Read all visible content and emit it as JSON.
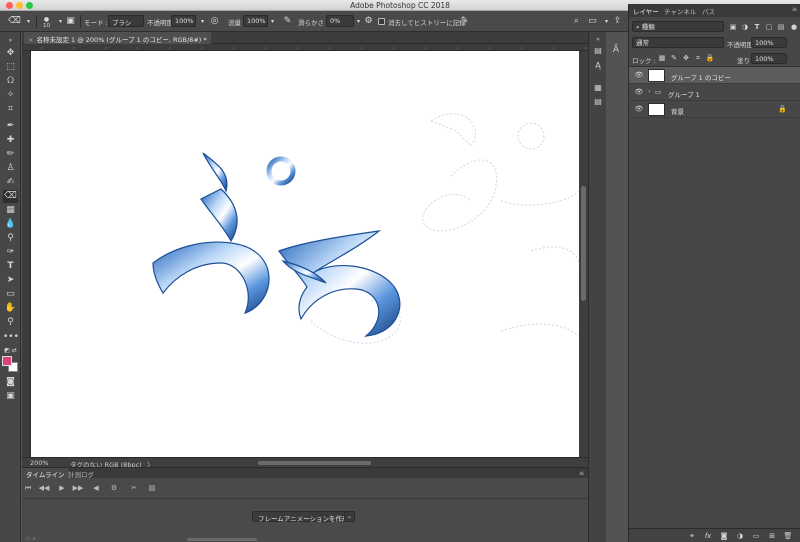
{
  "window": {
    "title": "Adobe Photoshop CC 2018"
  },
  "options_bar": {
    "brush_size": "10",
    "mode_label": "モード :",
    "mode_value": "ブラシ",
    "opacity_label": "不透明度 :",
    "opacity_value": "100%",
    "flow_label": "流量 :",
    "flow_value": "100%",
    "smoothing_label": "滑らかさ :",
    "smoothing_value": "0%",
    "history_label": "消去してヒストリーに記録"
  },
  "document": {
    "tab_title": "名称未設定 1 @ 200% (グループ 1 のコピー, RGB/8#) *"
  },
  "status_bar": {
    "zoom": "200%",
    "info": "タグのない RGB (8bpc)",
    "arrow": "〉"
  },
  "timeline": {
    "tabs": [
      "タイムライン",
      "計測ログ"
    ],
    "create_button": "フレームアニメーションを作成"
  },
  "panel": {
    "tabs": [
      "レイヤー",
      "チャンネル",
      "パス"
    ],
    "filter_kind": "種類",
    "blend_mode": "通常",
    "opacity_label": "不透明度 :",
    "opacity_value": "100%",
    "lock_label": "ロック :",
    "fill_label": "塗り :",
    "fill_value": "100%",
    "layers": [
      {
        "name": "グループ 1 のコピー",
        "selected": true
      },
      {
        "name": "グループ 1",
        "selected": false
      },
      {
        "name": "背景",
        "selected": false
      }
    ]
  },
  "canvas": {
    "artwork_text": "ぷろ"
  },
  "colors": {
    "foreground": "#d9417f",
    "background": "#ffffff",
    "accent_blue": "#3a78c6",
    "selected_layer": "#5c5c5c"
  }
}
